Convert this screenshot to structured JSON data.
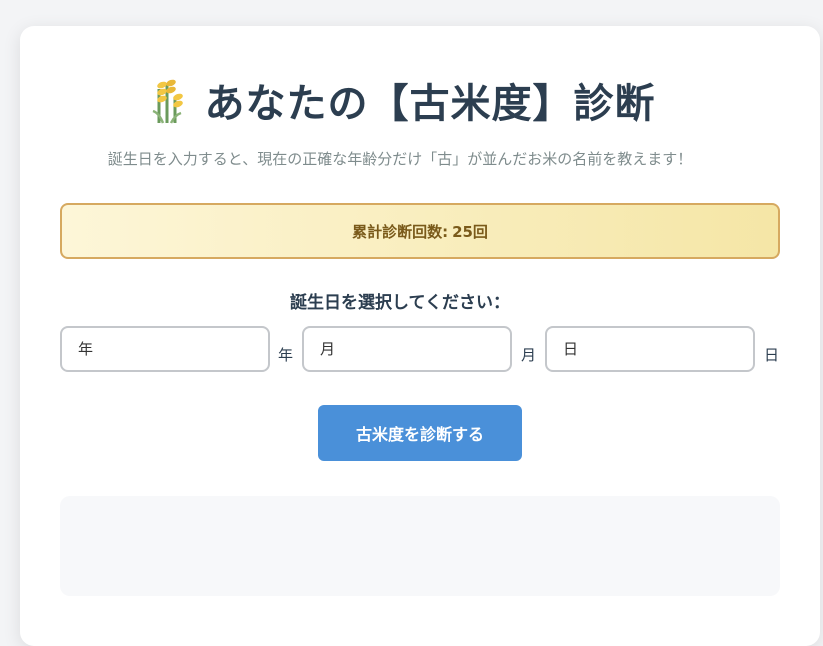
{
  "header": {
    "title": "あなたの【古米度】診断",
    "icon": "rice-plant-icon",
    "subtitle": "誕生日を入力すると、現在の正確な年齢分だけ「古」が並んだお米の名前を教えます！"
  },
  "counter": {
    "label": "累計診断回数:",
    "value": "25回"
  },
  "form": {
    "select_label": "誕生日を選択してください：",
    "year": {
      "placeholder": "年",
      "value": "",
      "unit": "年"
    },
    "month": {
      "placeholder": "月",
      "value": "",
      "unit": "月"
    },
    "day": {
      "placeholder": "日",
      "value": "",
      "unit": "日"
    },
    "submit_label": "古米度を診断する"
  },
  "colors": {
    "title": "#2c3e50",
    "button": "#4a90d9",
    "counter_border": "#d6a960",
    "counter_bg": "#f5e6a6"
  }
}
